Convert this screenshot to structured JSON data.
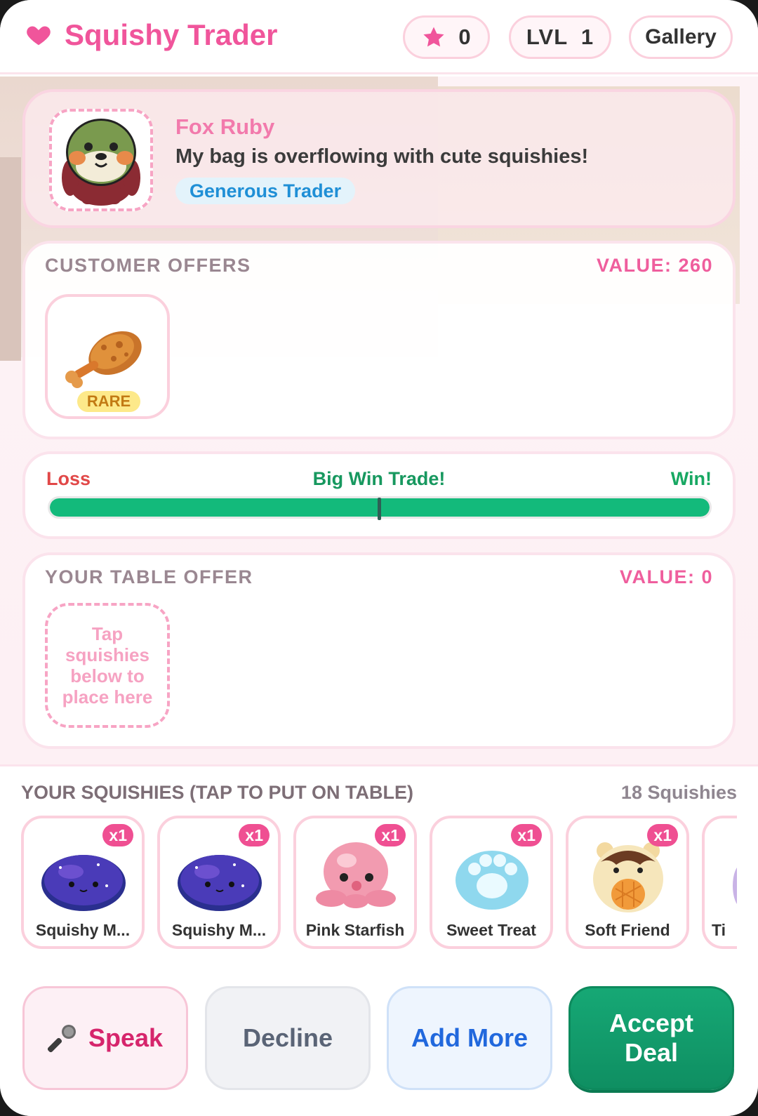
{
  "header": {
    "title": "Squishy Trader",
    "stars": "0",
    "level": "LVL  1",
    "gallery_label": "Gallery"
  },
  "trader": {
    "name": "Fox Ruby",
    "message": "My bag is overflowing with cute squishies!",
    "tag": "Generous Trader"
  },
  "customer_offers": {
    "title": "CUSTOMER OFFERS",
    "value_label": "VALUE: 260",
    "items": [
      {
        "rarity": "RARE",
        "icon": "fried-chicken-leg-icon"
      }
    ]
  },
  "meter": {
    "loss_label": "Loss",
    "status": "Big Win Trade!",
    "win_label": "Win!",
    "fill_fraction": 1.0,
    "colors": {
      "fill": "#13ba7b",
      "loss": "#e14848",
      "win": "#17a862"
    }
  },
  "table_offer": {
    "title": "YOUR TABLE OFFER",
    "value_label": "VALUE: 0",
    "placeholder": "Tap squishies below to place here"
  },
  "inventory": {
    "title": "YOUR SQUISHIES (TAP TO PUT ON TABLE)",
    "count_label": "18 Squishies",
    "items": [
      {
        "name": "Squishy M...",
        "qty": "x1",
        "icon": "galaxy-blob-icon"
      },
      {
        "name": "Squishy M...",
        "qty": "x1",
        "icon": "galaxy-blob-icon"
      },
      {
        "name": "Pink Starfish",
        "qty": "x1",
        "icon": "pink-octopus-icon"
      },
      {
        "name": "Sweet Treat",
        "qty": "x1",
        "icon": "paw-icon"
      },
      {
        "name": "Soft Friend",
        "qty": "x1",
        "icon": "bear-icon"
      },
      {
        "name": "Ti",
        "qty": "",
        "icon": "partial-item-icon"
      }
    ]
  },
  "actions": {
    "speak": "Speak",
    "decline": "Decline",
    "add_more": "Add More",
    "accept": "Accept Deal"
  },
  "colors": {
    "brand_pink": "#f0559b",
    "accept_green": "#13a36f",
    "add_more_blue": "#2168dd"
  }
}
